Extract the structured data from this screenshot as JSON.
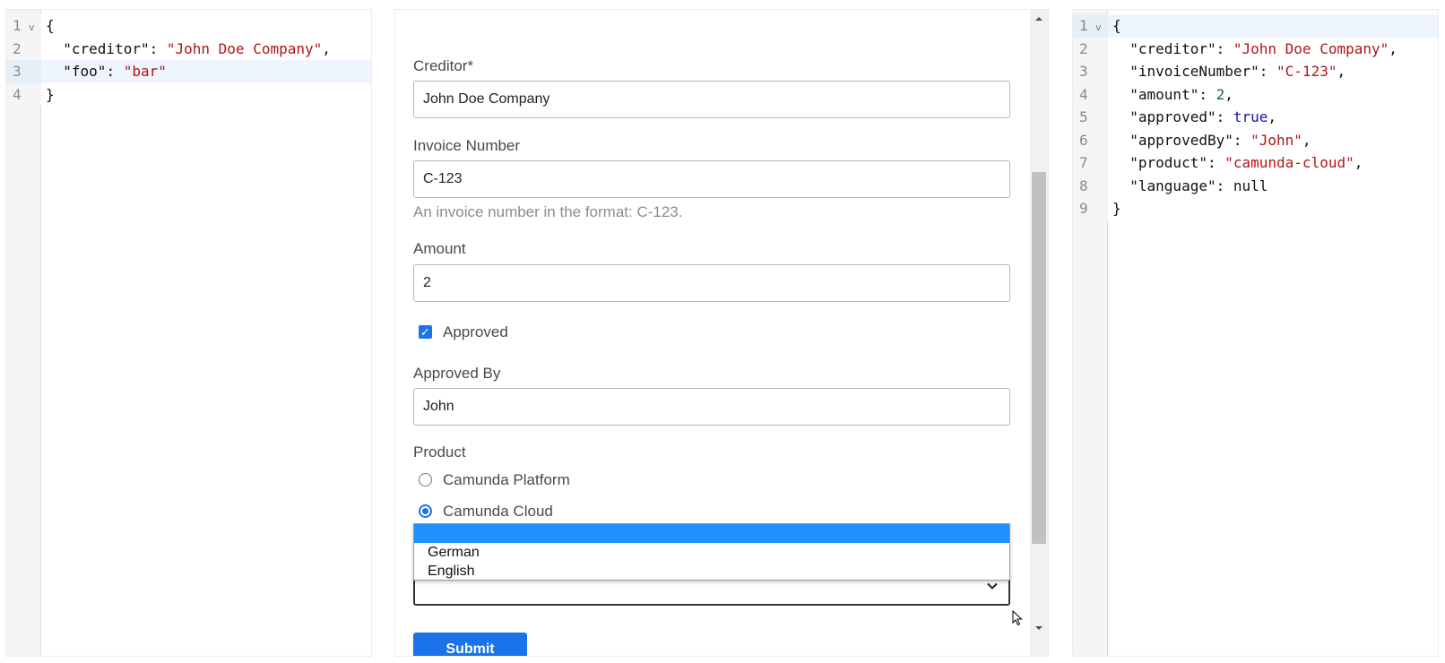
{
  "left_editor": {
    "lines": [
      {
        "num": "1",
        "fold": true,
        "tokens": [
          {
            "t": "{",
            "c": "punc"
          }
        ]
      },
      {
        "num": "2",
        "fold": false,
        "tokens": [
          {
            "t": "  ",
            "c": "punc"
          },
          {
            "t": "\"creditor\"",
            "c": "key"
          },
          {
            "t": ": ",
            "c": "punc"
          },
          {
            "t": "\"John Doe Company\"",
            "c": "str"
          },
          {
            "t": ",",
            "c": "punc"
          }
        ]
      },
      {
        "num": "3",
        "fold": false,
        "active": true,
        "tokens": [
          {
            "t": "  ",
            "c": "punc"
          },
          {
            "t": "\"foo\"",
            "c": "key"
          },
          {
            "t": ": ",
            "c": "punc"
          },
          {
            "t": "\"bar\"",
            "c": "str"
          }
        ]
      },
      {
        "num": "4",
        "fold": false,
        "tokens": [
          {
            "t": "}",
            "c": "punc"
          }
        ]
      }
    ]
  },
  "right_editor": {
    "lines": [
      {
        "num": "1",
        "fold": true,
        "active": true,
        "tokens": [
          {
            "t": "{",
            "c": "punc"
          }
        ]
      },
      {
        "num": "2",
        "fold": false,
        "tokens": [
          {
            "t": "  ",
            "c": "punc"
          },
          {
            "t": "\"creditor\"",
            "c": "key"
          },
          {
            "t": ": ",
            "c": "punc"
          },
          {
            "t": "\"John Doe Company\"",
            "c": "str"
          },
          {
            "t": ",",
            "c": "punc"
          }
        ]
      },
      {
        "num": "3",
        "fold": false,
        "tokens": [
          {
            "t": "  ",
            "c": "punc"
          },
          {
            "t": "\"invoiceNumber\"",
            "c": "key"
          },
          {
            "t": ": ",
            "c": "punc"
          },
          {
            "t": "\"C-123\"",
            "c": "str"
          },
          {
            "t": ",",
            "c": "punc"
          }
        ]
      },
      {
        "num": "4",
        "fold": false,
        "tokens": [
          {
            "t": "  ",
            "c": "punc"
          },
          {
            "t": "\"amount\"",
            "c": "key"
          },
          {
            "t": ": ",
            "c": "punc"
          },
          {
            "t": "2",
            "c": "num"
          },
          {
            "t": ",",
            "c": "punc"
          }
        ]
      },
      {
        "num": "5",
        "fold": false,
        "tokens": [
          {
            "t": "  ",
            "c": "punc"
          },
          {
            "t": "\"approved\"",
            "c": "key"
          },
          {
            "t": ": ",
            "c": "punc"
          },
          {
            "t": "true",
            "c": "atom"
          },
          {
            "t": ",",
            "c": "punc"
          }
        ]
      },
      {
        "num": "6",
        "fold": false,
        "tokens": [
          {
            "t": "  ",
            "c": "punc"
          },
          {
            "t": "\"approvedBy\"",
            "c": "key"
          },
          {
            "t": ": ",
            "c": "punc"
          },
          {
            "t": "\"John\"",
            "c": "str"
          },
          {
            "t": ",",
            "c": "punc"
          }
        ]
      },
      {
        "num": "7",
        "fold": false,
        "tokens": [
          {
            "t": "  ",
            "c": "punc"
          },
          {
            "t": "\"product\"",
            "c": "key"
          },
          {
            "t": ": ",
            "c": "punc"
          },
          {
            "t": "\"camunda-cloud\"",
            "c": "str"
          },
          {
            "t": ",",
            "c": "punc"
          }
        ]
      },
      {
        "num": "8",
        "fold": false,
        "tokens": [
          {
            "t": "  ",
            "c": "punc"
          },
          {
            "t": "\"language\"",
            "c": "key"
          },
          {
            "t": ": ",
            "c": "punc"
          },
          {
            "t": "null",
            "c": "null"
          }
        ]
      },
      {
        "num": "9",
        "fold": false,
        "tokens": [
          {
            "t": "}",
            "c": "punc"
          }
        ]
      }
    ]
  },
  "form": {
    "creditor_label": "Creditor*",
    "creditor_value": "John Doe Company",
    "invoice_label": "Invoice Number",
    "invoice_value": "C-123",
    "invoice_description": "An invoice number in the format: C-123.",
    "amount_label": "Amount",
    "amount_value": "2",
    "approved_label": "Approved",
    "approved_checked": true,
    "approved_by_label": "Approved By",
    "approved_by_value": "John",
    "product_label": "Product",
    "product_options": [
      {
        "label": "Camunda Platform",
        "checked": false
      },
      {
        "label": "Camunda Cloud",
        "checked": true
      }
    ],
    "language_value": "",
    "language_options": [
      "",
      "German",
      "English"
    ],
    "submit_label": "Submit"
  },
  "colors": {
    "accent": "#1a73e8",
    "dropdown_highlight": "#1e90ff",
    "json_string": "#b31515",
    "json_number": "#116644",
    "json_atom": "#1515a8"
  }
}
